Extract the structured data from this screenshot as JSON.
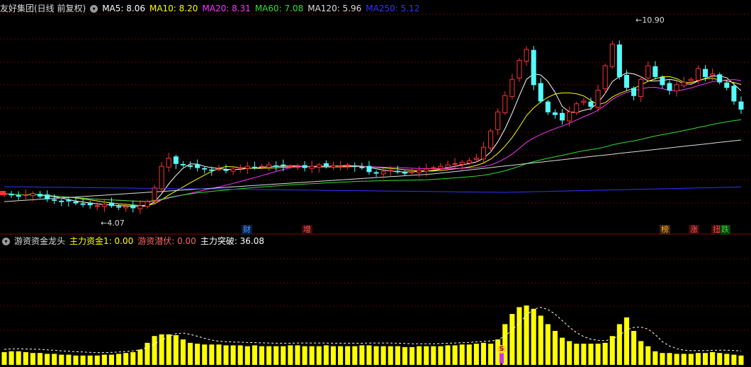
{
  "header": {
    "title": "友好集团(日线 前复权)",
    "ma": [
      {
        "label": "MA5: 8.06",
        "color": "#ffffff"
      },
      {
        "label": "MA10: 8.20",
        "color": "#ffff00"
      },
      {
        "label": "MA20: 8.31",
        "color": "#ff33ff"
      },
      {
        "label": "MA60: 7.08",
        "color": "#33dd33"
      },
      {
        "label": "MA120: 5.96",
        "color": "#dddddd"
      },
      {
        "label": "MA250: 5.12",
        "color": "#3333ff"
      }
    ]
  },
  "sub_header": {
    "title": "游资资金龙头",
    "items": [
      {
        "label": "主力资金1: 0.00",
        "color": "#ffff00"
      },
      {
        "label": "游资潜伏: 0.00",
        "color": "#ff6666"
      },
      {
        "label": "主力突破: 36.08",
        "color": "#ffffff"
      }
    ]
  },
  "price_labels": {
    "high": "10.90",
    "low": "4.07"
  },
  "event_marks": [
    {
      "text": "财",
      "color": "#5599ff"
    },
    {
      "text": "增",
      "color": "#ff5555"
    },
    {
      "text": "榜",
      "color": "#ffaa33"
    },
    {
      "text": "涨",
      "color": "#ff5555"
    },
    {
      "text": "扭",
      "color": "#ff5555"
    },
    {
      "text": "跌",
      "color": "#33dd33"
    }
  ],
  "sub_marker": "S",
  "colors": {
    "up": "#ff3232",
    "down": "#54fcfc",
    "grid": "#6e0000",
    "bars": "#ffff00"
  },
  "chart_data": {
    "type": "candlestick",
    "closes": [
      4.6,
      4.55,
      4.5,
      4.55,
      4.6,
      4.5,
      4.4,
      4.35,
      4.3,
      4.32,
      4.25,
      4.2,
      4.18,
      4.15,
      4.2,
      4.15,
      4.1,
      4.12,
      4.07,
      4.15,
      4.3,
      4.8,
      5.6,
      5.9,
      5.7,
      5.65,
      5.6,
      5.55,
      5.5,
      5.45,
      5.5,
      5.45,
      5.5,
      5.55,
      5.6,
      5.55,
      5.6,
      5.65,
      5.6,
      5.62,
      5.6,
      5.58,
      5.55,
      5.6,
      5.65,
      5.6,
      5.62,
      5.6,
      5.65,
      5.6,
      5.55,
      5.4,
      5.35,
      5.4,
      5.45,
      5.4,
      5.35,
      5.4,
      5.45,
      5.5,
      5.55,
      5.6,
      5.65,
      5.7,
      5.75,
      5.8,
      5.9,
      6.3,
      6.9,
      7.6,
      8.2,
      8.8,
      9.5,
      9.9,
      8.6,
      8.0,
      7.6,
      7.5,
      7.3,
      7.6,
      7.9,
      8.0,
      7.8,
      8.4,
      9.3,
      10.1,
      8.9,
      8.5,
      8.2,
      8.8,
      9.3,
      8.9,
      8.6,
      8.4,
      8.6,
      8.7,
      8.8,
      9.2,
      8.9,
      9.0,
      8.7,
      8.5,
      8.0,
      7.7
    ],
    "ma_values": {
      "MA5": 8.06,
      "MA10": 8.2,
      "MA20": 8.31,
      "MA60": 7.08,
      "MA120": 5.96,
      "MA250": 5.12
    },
    "high": 10.9,
    "low": 4.07,
    "volume": [
      15,
      16,
      16,
      15,
      14,
      14,
      13,
      13,
      12,
      12,
      11,
      11,
      11,
      11,
      12,
      12,
      13,
      14,
      15,
      18,
      26,
      34,
      36,
      36,
      35,
      30,
      26,
      25,
      24,
      24,
      24,
      23,
      23,
      23,
      22,
      23,
      22,
      22,
      22,
      22,
      23,
      23,
      22,
      22,
      22,
      23,
      22,
      22,
      22,
      22,
      23,
      23,
      22,
      22,
      22,
      22,
      21,
      21,
      22,
      22,
      22,
      22,
      23,
      23,
      24,
      24,
      25,
      26,
      25,
      30,
      48,
      60,
      68,
      70,
      66,
      58,
      48,
      40,
      32,
      28,
      25,
      25,
      25,
      25,
      26,
      34,
      48,
      56,
      40,
      28,
      22,
      16,
      14,
      14,
      13,
      13,
      13,
      14,
      14,
      15,
      14,
      13,
      12,
      11
    ]
  }
}
